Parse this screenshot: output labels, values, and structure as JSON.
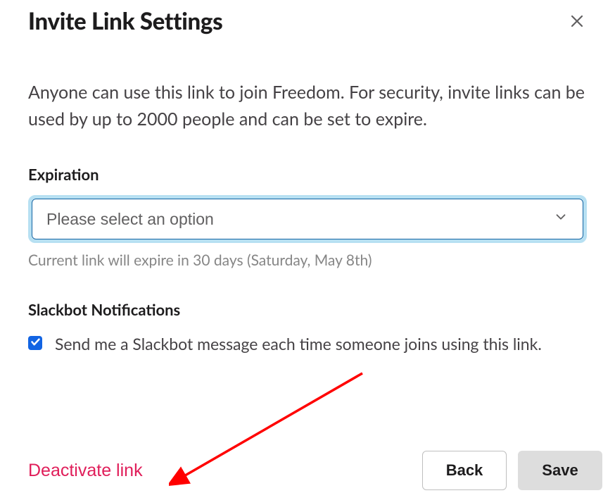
{
  "dialog": {
    "title": "Invite Link Settings",
    "description": "Anyone can use this link to join Freedom. For security, invite links can be used by up to 2000 people and can be set to expire."
  },
  "expiration": {
    "label": "Expiration",
    "placeholder": "Please select an option",
    "hint": "Current link will expire in 30 days (Saturday, May 8th)"
  },
  "notifications": {
    "label": "Slackbot Notifications",
    "checkbox_label": "Send me a Slackbot message each time someone joins using this link.",
    "checked": true
  },
  "actions": {
    "deactivate": "Deactivate link",
    "back": "Back",
    "save": "Save"
  },
  "colors": {
    "danger": "#e01e5a",
    "primary_blue": "#1264a3",
    "focus_ring": "#b7e0f2",
    "checkbox_blue": "#1264e3"
  }
}
